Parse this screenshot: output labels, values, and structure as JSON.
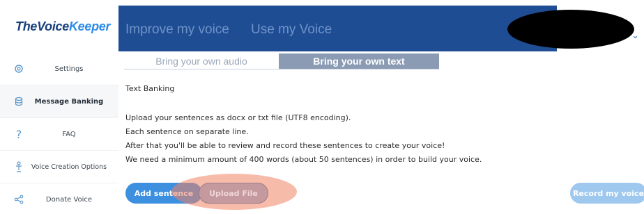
{
  "logo": {
    "part1": "TheVoice",
    "part2": "Keeper"
  },
  "sidebar": {
    "items": [
      {
        "label": "Settings",
        "icon": "gear-icon",
        "active": false
      },
      {
        "label": "Message Banking",
        "icon": "database-icon",
        "active": true
      },
      {
        "label": "FAQ",
        "icon": "question-icon",
        "active": false
      },
      {
        "label": "Voice Creation Options",
        "icon": "voice-options-icon",
        "active": false
      },
      {
        "label": "Donate Voice",
        "icon": "share-icon",
        "active": false
      }
    ]
  },
  "header": {
    "tabs": [
      {
        "label": "Improve my voice"
      },
      {
        "label": "Use my Voice"
      }
    ]
  },
  "subtabs": [
    {
      "label": "Bring your own audio",
      "active": false
    },
    {
      "label": "Bring your own text",
      "active": true
    }
  ],
  "main": {
    "heading": "Text Banking",
    "lines": [
      "Upload your sentences as docx or txt file (UTF8 encoding).",
      "Each sentence on separate line.",
      "After that you'll be able to review and record these sentences to create your voice!",
      "We need a minimum amount of 400 words (about 50 sentences) in order to build your voice."
    ]
  },
  "buttons": {
    "add_sentence": "Add sentence",
    "upload_file": "Upload File",
    "record": "Record my voice"
  },
  "colors": {
    "header_bg": "#1f4d94",
    "accent": "#3d8fe0",
    "active_subtab": "#8b9bb4",
    "highlight": "#f08462"
  }
}
